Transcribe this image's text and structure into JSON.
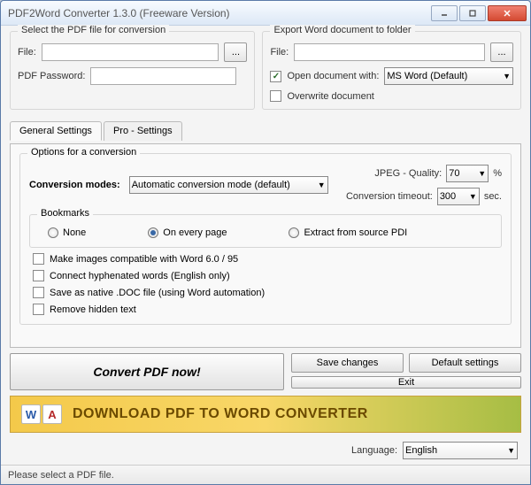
{
  "window": {
    "title": "PDF2Word Converter 1.3.0 (Freeware Version)"
  },
  "leftPanel": {
    "title": "Select the PDF file for conversion",
    "fileLabel": "File:",
    "fileValue": "",
    "browseLabel": "...",
    "passwordLabel": "PDF Password:",
    "passwordValue": ""
  },
  "rightPanel": {
    "title": "Export Word document to folder",
    "fileLabel": "File:",
    "fileValue": "",
    "browseLabel": "...",
    "openWithLabel": "Open document with:",
    "openWithValue": "MS Word (Default)",
    "overwriteLabel": "Overwrite document"
  },
  "tabs": {
    "general": "General Settings",
    "pro": "Pro - Settings"
  },
  "conversion": {
    "groupTitle": "Options for a conversion",
    "modesLabel": "Conversion modes:",
    "modeValue": "Automatic conversion mode (default)",
    "jpegLabel": "JPEG - Quality:",
    "jpegValue": "70",
    "jpegUnit": "%",
    "timeoutLabel": "Conversion timeout:",
    "timeoutValue": "300",
    "timeoutUnit": "sec."
  },
  "bookmarks": {
    "title": "Bookmarks",
    "none": "None",
    "every": "On every page",
    "extract": "Extract from source PDI"
  },
  "checklist": {
    "compat": "Make images compatible with Word 6.0 / 95",
    "hyphen": "Connect hyphenated words (English only)",
    "native": "Save as native .DOC file (using Word automation)",
    "hidden": "Remove hidden text"
  },
  "buttons": {
    "convert": "Convert PDF now!",
    "save": "Save changes",
    "defaults": "Default settings",
    "exit": "Exit"
  },
  "banner": {
    "text": "DOWNLOAD PDF TO WORD CONVERTER"
  },
  "language": {
    "label": "Language:",
    "value": "English"
  },
  "status": "Please select a PDF file."
}
